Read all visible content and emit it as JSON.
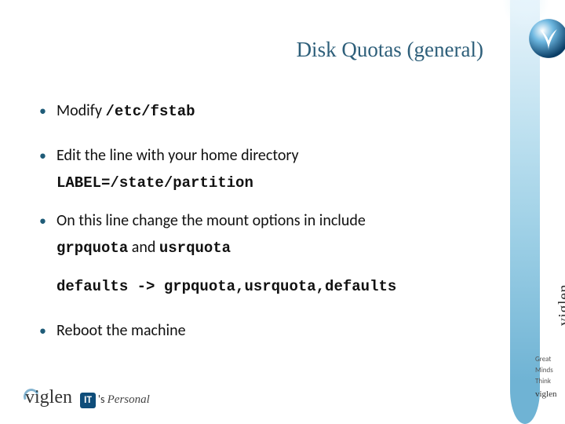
{
  "title": "Disk Quotas (general)",
  "bullets": {
    "b1_pre": "Modify ",
    "b1_code": "/etc/fstab",
    "b2": "Edit the line with your home directory",
    "b2_code": "LABEL=/state/partition",
    "b3": "On this line change the mount options in include",
    "b3_sub_a": "grpquota",
    "b3_sub_mid": " and ",
    "b3_sub_b": "usrquota",
    "b3_code": "defaults -> grpquota,usrquota,defaults",
    "b4": "Reboot the machine"
  },
  "brand": {
    "name": "viglen",
    "tag1": "Great",
    "tag2": "Minds",
    "tag3": "Think",
    "footer_it": "IT",
    "footer_s": "'s ",
    "footer_personal": "Personal"
  }
}
